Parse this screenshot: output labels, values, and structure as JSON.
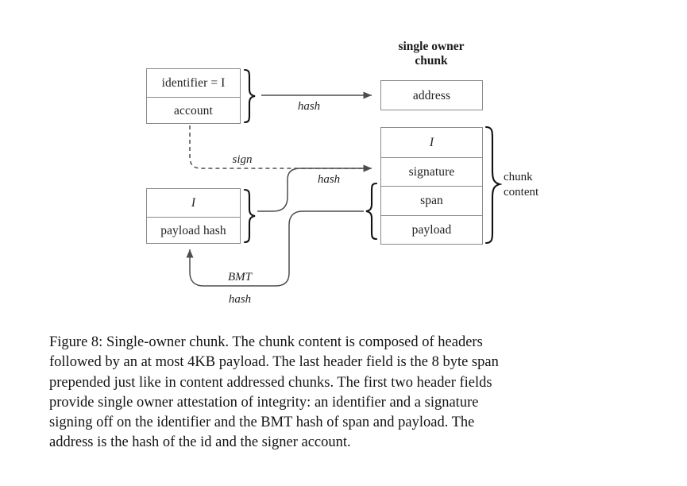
{
  "figure": {
    "diagram_title": {
      "line1": "single owner",
      "line2": "chunk"
    },
    "boxes": [
      {
        "name": "identifier-account-box",
        "rows": [
          {
            "text": "identifier = I"
          },
          {
            "text": "account"
          }
        ]
      },
      {
        "name": "identifier-payload-hash-box",
        "rows": [
          {
            "text": "I"
          },
          {
            "text": "payload hash"
          }
        ]
      },
      {
        "name": "address-box",
        "rows": [
          {
            "text": "address"
          }
        ]
      },
      {
        "name": "chunk-box",
        "rows": [
          {
            "text": "I"
          },
          {
            "text": "signature"
          },
          {
            "text": "span"
          },
          {
            "text": "payload"
          }
        ]
      }
    ],
    "edge_labels": {
      "hash_top": "hash",
      "sign": "sign",
      "hash_mid": "hash",
      "bmt": "BMT",
      "bmt_hash": "hash"
    },
    "brace_labels": {
      "chunk_content_line1": "chunk",
      "chunk_content_line2": "content"
    },
    "colors": {
      "background": "#ffffff",
      "box_border": "#8a8a8a",
      "arrow": "#4d4d4d",
      "brace": "#111111",
      "text": "#1a1a1a"
    }
  },
  "caption": {
    "lines": [
      "Figure 8: Single-owner chunk.  The chunk content is composed of headers",
      "followed by an at most 4KB payload. The last header field is the 8 byte span",
      "prepended just like in content addressed chunks.  The first two header fields",
      "provide single owner attestation of integrity:  an identifier and a signature",
      "signing off on the identifier and the BMT hash of span and payload.  The",
      "address is the hash of the id and the signer account."
    ]
  }
}
